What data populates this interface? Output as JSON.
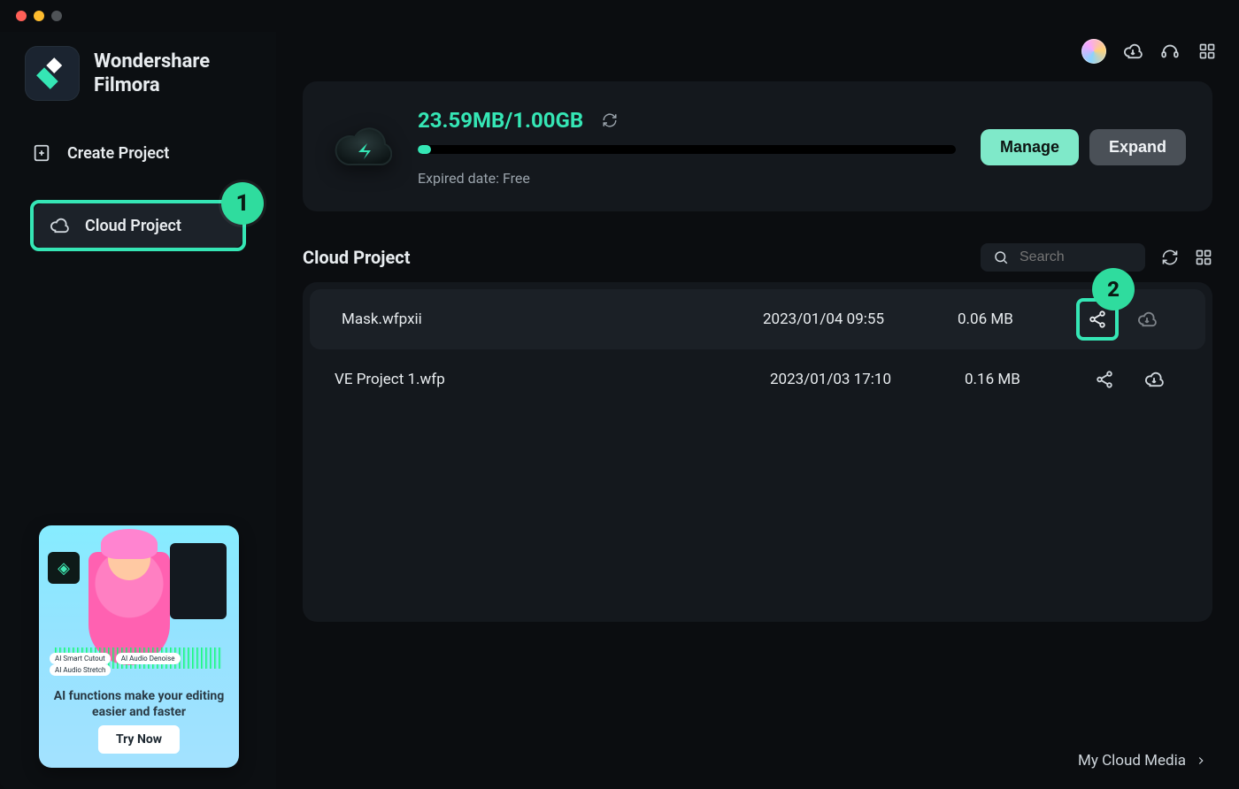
{
  "brand": {
    "line1": "Wondershare",
    "line2": "Filmora"
  },
  "sidebar": {
    "items": [
      {
        "icon": "add-file-icon",
        "label": "Create Project"
      },
      {
        "icon": "cloud-icon",
        "label": "Cloud Project"
      }
    ],
    "activeIndex": 1,
    "highlight": {
      "index": 1,
      "badge": "1"
    }
  },
  "promo": {
    "chips": [
      "AI Smart Cutout",
      "AI Audio Denoise",
      "AI Audio Stretch"
    ],
    "caption": "AI functions make your editing easier and faster",
    "button": "Try Now"
  },
  "storage": {
    "usage": "23.59MB/1.00GB",
    "expired": "Expired date: Free",
    "manage": "Manage",
    "expand": "Expand"
  },
  "section": {
    "title": "Cloud Project"
  },
  "search": {
    "placeholder": "Search"
  },
  "files": [
    {
      "name": "Mask.wfpxii",
      "date": "2023/01/04 09:55",
      "size": "0.06 MB"
    },
    {
      "name": "VE Project 1.wfp",
      "date": "2023/01/03 17:10",
      "size": "0.16 MB"
    }
  ],
  "shareHighlight": {
    "row": 0,
    "badge": "2"
  },
  "footer": {
    "link": "My Cloud Media"
  }
}
